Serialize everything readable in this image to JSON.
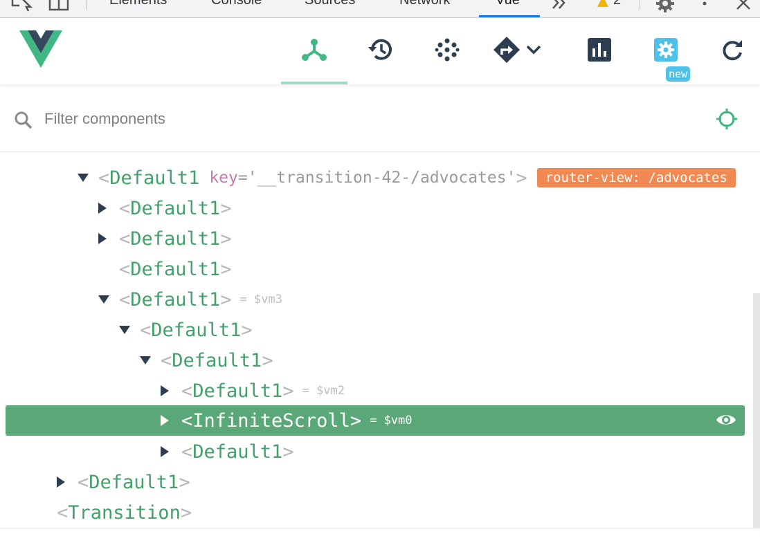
{
  "devtools_tabs": [
    {
      "label": "Elements"
    },
    {
      "label": "Console"
    },
    {
      "label": "Sources"
    },
    {
      "label": "Network"
    },
    {
      "label": "Vue"
    }
  ],
  "devtools_warning_count": "2",
  "header": {
    "new_badge": "new"
  },
  "filter": {
    "placeholder": "Filter components"
  },
  "tree": {
    "rows": [
      {
        "name": "Default1",
        "attr_key": "key",
        "attr_value": "='__transition-42-/advocates'",
        "badge": "router-view: /advocates"
      },
      {
        "name": "Default1"
      },
      {
        "name": "Default1"
      },
      {
        "name": "Default1"
      },
      {
        "name": "Default1",
        "vm": "= $vm3"
      },
      {
        "name": "Default1"
      },
      {
        "name": "Default1"
      },
      {
        "name": "Default1",
        "vm": "= $vm2"
      },
      {
        "name": "InfiniteScroll",
        "vm": "= $vm0"
      },
      {
        "name": "Default1"
      },
      {
        "name": "Default1"
      },
      {
        "name": "Transition"
      }
    ]
  },
  "colors": {
    "vue_green": "#41b883",
    "vue_dark": "#35495e",
    "selected_row": "#5aa877",
    "badge_orange": "#f08a52",
    "new_badge": "#4fc0e8"
  }
}
